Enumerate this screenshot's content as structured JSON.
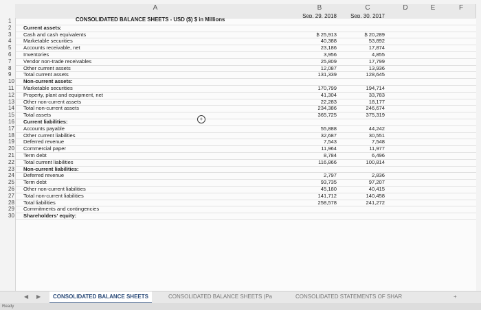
{
  "columns": [
    "A",
    "B",
    "C",
    "D",
    "E",
    "F"
  ],
  "header": {
    "title": "CONSOLIDATED BALANCE SHEETS - USD ($) $ in Millions",
    "col_b": "Sep. 29, 2018",
    "col_c": "Sep. 30, 2017"
  },
  "rows": [
    {
      "n": "1",
      "label": ""
    },
    {
      "n": "2",
      "label": "Current assets:"
    },
    {
      "n": "3",
      "label": "Cash and cash equivalents"
    },
    {
      "n": "4",
      "label": "Marketable securities"
    },
    {
      "n": "5",
      "label": "Accounts receivable, net"
    },
    {
      "n": "6",
      "label": "Inventories"
    },
    {
      "n": "7",
      "label": "Vendor non-trade receivables"
    },
    {
      "n": "8",
      "label": "Other current assets"
    },
    {
      "n": "9",
      "label": "Total current assets"
    },
    {
      "n": "10",
      "label": "Non-current assets:"
    },
    {
      "n": "11",
      "label": "Marketable securities"
    },
    {
      "n": "12",
      "label": "Property, plant and equipment, net"
    },
    {
      "n": "13",
      "label": "Other non-current assets"
    },
    {
      "n": "14",
      "label": "Total non-current assets"
    },
    {
      "n": "15",
      "label": "Total assets"
    },
    {
      "n": "16",
      "label": "Current liabilities:"
    },
    {
      "n": "17",
      "label": "Accounts payable"
    },
    {
      "n": "18",
      "label": "Other current liabilities"
    },
    {
      "n": "19",
      "label": "Deferred revenue"
    },
    {
      "n": "20",
      "label": "Commercial paper"
    },
    {
      "n": "21",
      "label": "Term debt"
    },
    {
      "n": "22",
      "label": "Total current liabilities"
    },
    {
      "n": "23",
      "label": "Non-current liabilities:"
    },
    {
      "n": "24",
      "label": "Deferred revenue"
    },
    {
      "n": "25",
      "label": "Term debt"
    },
    {
      "n": "26",
      "label": "Other non-current liabilities"
    },
    {
      "n": "27",
      "label": "Total non-current liabilities"
    },
    {
      "n": "28",
      "label": "Total liabilities"
    },
    {
      "n": "29",
      "label": "Commitments and contingencies"
    },
    {
      "n": "30",
      "label": "Shareholders' equity:"
    }
  ],
  "values": {
    "b": [
      "$ 25,913",
      "40,388",
      "23,186",
      "3,956",
      "25,809",
      "12,087",
      "131,339",
      "170,799",
      "41,304",
      "22,283",
      "234,386",
      "365,725",
      "55,888",
      "32,687",
      "7,543",
      "11,964",
      "8,784",
      "116,866",
      "2,797",
      "93,735",
      "45,180",
      "141,712",
      "258,578"
    ],
    "c": [
      "$ 20,289",
      "53,892",
      "17,874",
      "4,855",
      "17,799",
      "13,936",
      "128,645",
      "194,714",
      "33,783",
      "18,177",
      "246,674",
      "375,319",
      "44,242",
      "30,551",
      "7,548",
      "11,977",
      "6,496",
      "100,814",
      "2,836",
      "97,207",
      "40,415",
      "140,458",
      "241,272"
    ]
  },
  "tabs": [
    "CONSOLIDATED BALANCE SHEETS",
    "CONSOLIDATED BALANCE SHEETS (Pa",
    "CONSOLIDATED STATEMENTS OF SHAR"
  ],
  "status": "Ready"
}
